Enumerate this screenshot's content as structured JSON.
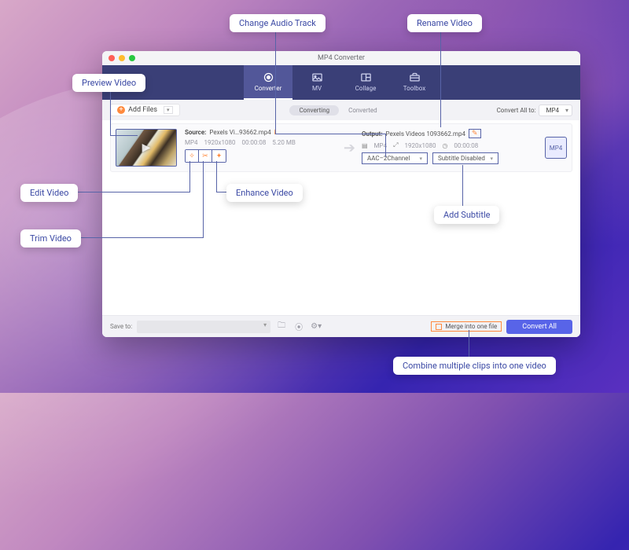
{
  "window": {
    "title": "MP4 Converter"
  },
  "nav": {
    "converter": "Converter",
    "mv": "MV",
    "collage": "Collage",
    "toolbox": "Toolbox"
  },
  "toolbar": {
    "add_files": "Add Files",
    "converting": "Converting",
    "converted": "Converted",
    "convert_all_to": "Convert All to:",
    "format": "MP4"
  },
  "item": {
    "source_label": "Source:",
    "source_name": "Pexels Vi…93662.mp4",
    "meta_format": "MP4",
    "meta_res": "1920x1080",
    "meta_dur": "00:00:08",
    "meta_size": "5.20 MB",
    "output_label": "Output:",
    "output_name": "Pexels Videos 1093662.mp4",
    "out_format": "MP4",
    "out_res": "1920x1080",
    "out_dur": "00:00:08",
    "audio_track": "AAC–2Channel",
    "subtitle": "Subtitle Disabled",
    "format_icon": "MP4"
  },
  "bottom": {
    "save_to": "Save to:",
    "merge": "Merge into one file",
    "convert_all": "Convert All"
  },
  "annotations": {
    "change_audio": "Change Audio Track",
    "rename": "Rename Video",
    "preview": "Preview Video",
    "edit": "Edit Video",
    "trim": "Trim Video",
    "enhance": "Enhance Video",
    "add_subtitle": "Add Subtitle",
    "combine": "Combine multiple clips into one video"
  }
}
